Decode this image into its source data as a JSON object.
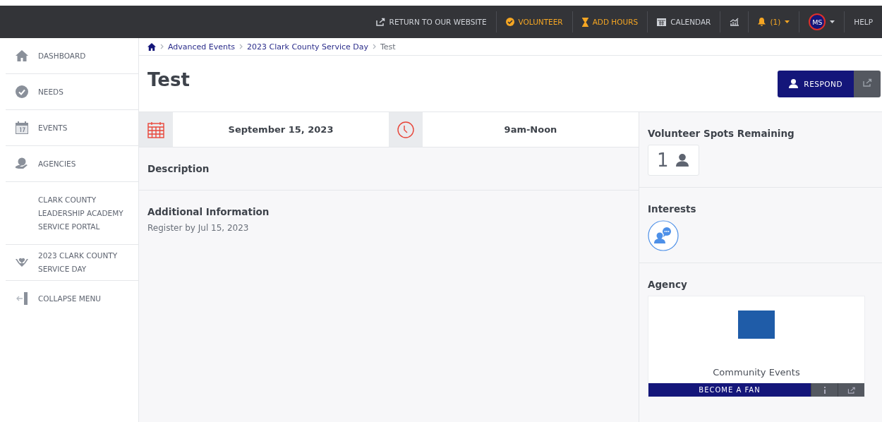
{
  "topbar": {
    "links": [
      {
        "kind": "website",
        "label": "RETURN TO OUR WEBSITE",
        "highlight": false
      },
      {
        "kind": "volunteer",
        "label": "VOLUNTEER",
        "highlight": true
      },
      {
        "kind": "hours",
        "label": "ADD HOURS",
        "highlight": true
      },
      {
        "kind": "calendar",
        "label": "CALENDAR",
        "highlight": false
      },
      {
        "kind": "stats",
        "highlight": false
      },
      {
        "kind": "bell",
        "label": "(1)",
        "highlight": true
      },
      {
        "kind": "avatar",
        "label": "MS",
        "highlight": false
      },
      {
        "kind": "help",
        "label": "HELP",
        "highlight": false
      }
    ]
  },
  "sidebar": {
    "items": [
      {
        "kind": "home",
        "label": "DASHBOARD"
      },
      {
        "kind": "check",
        "label": "NEEDS"
      },
      {
        "kind": "calendar",
        "label": "EVENTS"
      },
      {
        "kind": "globe",
        "label": "AGENCIES"
      },
      {
        "kind": "none",
        "label": "CLARK COUNTY LEADERSHIP ACADEMY SERVICE PORTAL"
      },
      {
        "kind": "heart",
        "label": "2023 CLARK COUNTY SERVICE DAY"
      },
      {
        "kind": "collapse",
        "label": "COLLAPSE MENU"
      }
    ]
  },
  "breadcrumb": [
    "Advanced Events",
    "2023 Clark County Service Day",
    "Test"
  ],
  "title": "Test",
  "respond_button": "RESPOND",
  "date": "September 15, 2023",
  "time": "9am-Noon",
  "description_heading": "Description",
  "additional_heading": "Additional Information",
  "additional_text": "Register by Jul 15, 2023",
  "spots": {
    "heading": "Volunteer Spots Remaining",
    "count": "1"
  },
  "interests_heading": "Interests",
  "agency": {
    "heading": "Agency",
    "name": "Community Events",
    "fan_button": "BECOME A FAN"
  }
}
